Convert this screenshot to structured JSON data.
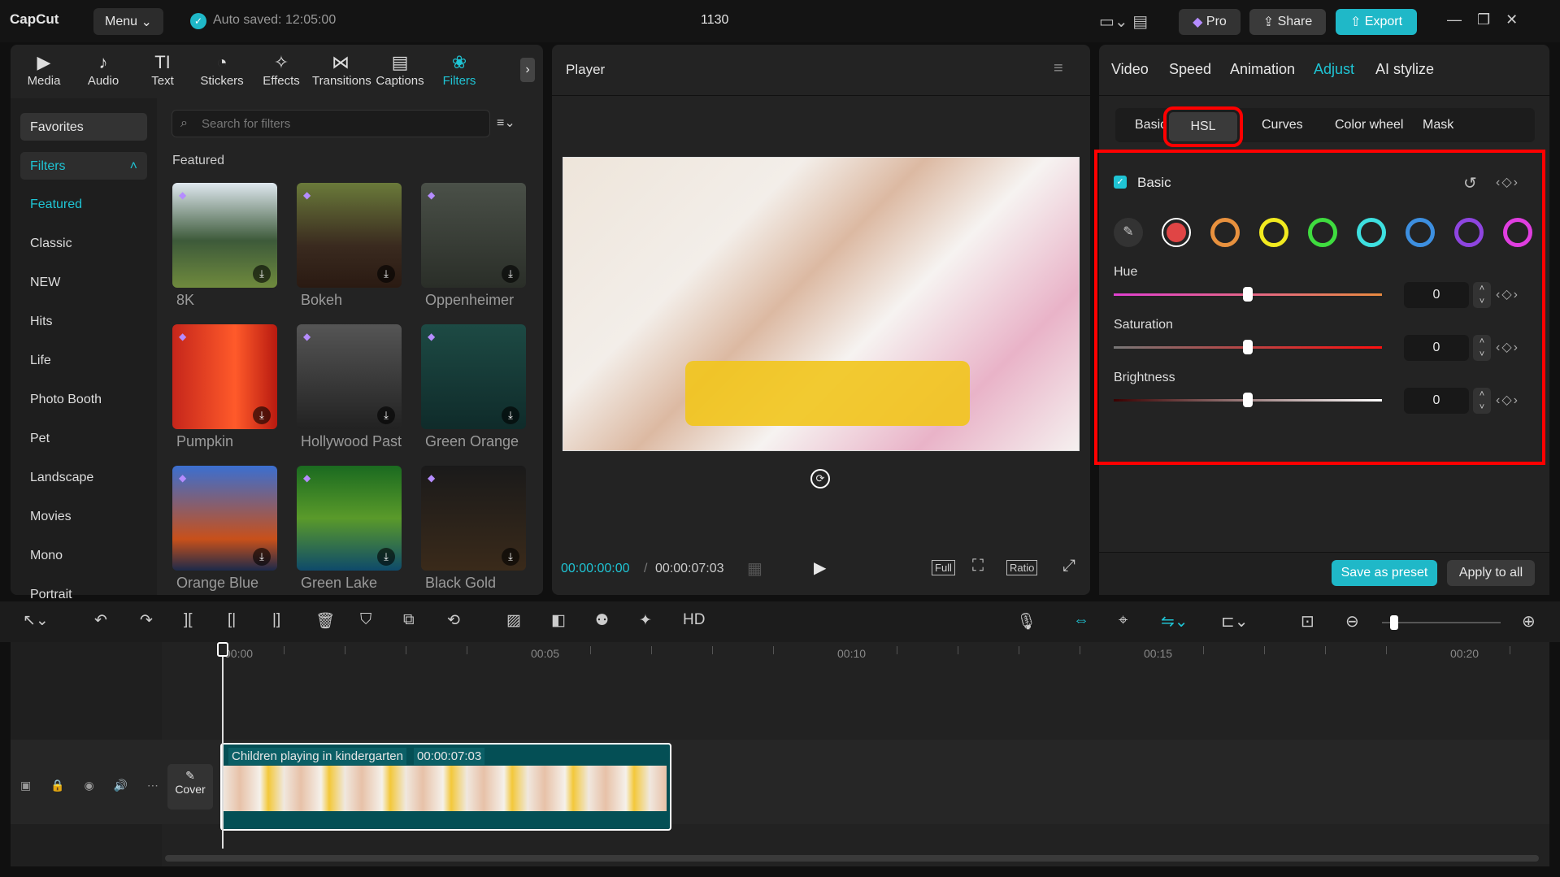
{
  "app": {
    "logo": "CapCut",
    "menu": "Menu",
    "autosave": "Auto saved: 12:05:00",
    "project": "1130",
    "pro": "Pro",
    "share": "Share",
    "export": "Export"
  },
  "media_tabs": [
    {
      "label": "Media",
      "icon": "▶"
    },
    {
      "label": "Audio",
      "icon": "♪"
    },
    {
      "label": "Text",
      "icon": "TI"
    },
    {
      "label": "Stickers",
      "icon": "◔"
    },
    {
      "label": "Effects",
      "icon": "✧"
    },
    {
      "label": "Transitions",
      "icon": "⋈"
    },
    {
      "label": "Captions",
      "icon": "▤"
    },
    {
      "label": "Filters",
      "icon": "❀"
    }
  ],
  "sidebar": {
    "favorites": "Favorites",
    "filters": "Filters",
    "items": [
      "Featured",
      "Classic",
      "NEW",
      "Hits",
      "Life",
      "Photo Booth",
      "Pet",
      "Landscape",
      "Movies",
      "Mono",
      "Portrait"
    ]
  },
  "search": {
    "placeholder": "Search for filters"
  },
  "section_title": "Featured",
  "filters": [
    {
      "name": "8K"
    },
    {
      "name": "Bokeh"
    },
    {
      "name": "Oppenheimer"
    },
    {
      "name": "Pumpkin"
    },
    {
      "name": "Hollywood Past"
    },
    {
      "name": "Green Orange"
    },
    {
      "name": "Orange Blue"
    },
    {
      "name": "Green Lake"
    },
    {
      "name": "Black Gold"
    }
  ],
  "player": {
    "title": "Player",
    "current": "00:00:00:00",
    "total": "00:00:07:03",
    "full": "Full",
    "ratio": "Ratio"
  },
  "right": {
    "tabs": [
      "Video",
      "Speed",
      "Animation",
      "Adjust",
      "AI stylize"
    ],
    "subtabs": [
      "Basic",
      "HSL",
      "Curves",
      "Color wheel",
      "Mask"
    ],
    "section": "Basic",
    "colors": [
      "#e04545",
      "#e8913e",
      "#f2ea1f",
      "#3fdc3f",
      "#3ee0e0",
      "#3d8fe0",
      "#8e45e0",
      "#e03ee0"
    ],
    "sliders": [
      {
        "label": "Hue",
        "value": "0",
        "position": 0.5
      },
      {
        "label": "Saturation",
        "value": "0",
        "position": 0.5
      },
      {
        "label": "Brightness",
        "value": "0",
        "position": 0.5
      }
    ],
    "save_preset": "Save as preset",
    "apply_all": "Apply to all"
  },
  "timeline": {
    "ticks": [
      "00:00",
      "00:05",
      "00:10",
      "00:15",
      "00:20"
    ],
    "clip_name": "Children playing in kindergarten",
    "clip_duration": "00:00:07:03",
    "cover": "Cover"
  }
}
